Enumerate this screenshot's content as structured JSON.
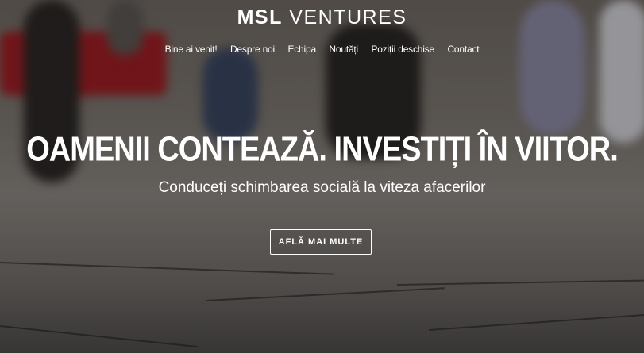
{
  "brand": {
    "logo_bold": "MSL",
    "logo_rest": " VENTURES"
  },
  "nav": {
    "items": [
      {
        "label": "Bine ai venit!"
      },
      {
        "label": "Despre noi"
      },
      {
        "label": "Echipa"
      },
      {
        "label": "Noutăți"
      },
      {
        "label": "Poziții deschise"
      },
      {
        "label": "Contact"
      }
    ]
  },
  "hero": {
    "headline": "OAMENII CONTEAZĂ. INVESTIȚI ÎN VIITOR.",
    "subtitle": "Conduceți schimbarea socială la viteza afacerilor",
    "cta_label": "AFLĂ MAI MULTE"
  }
}
